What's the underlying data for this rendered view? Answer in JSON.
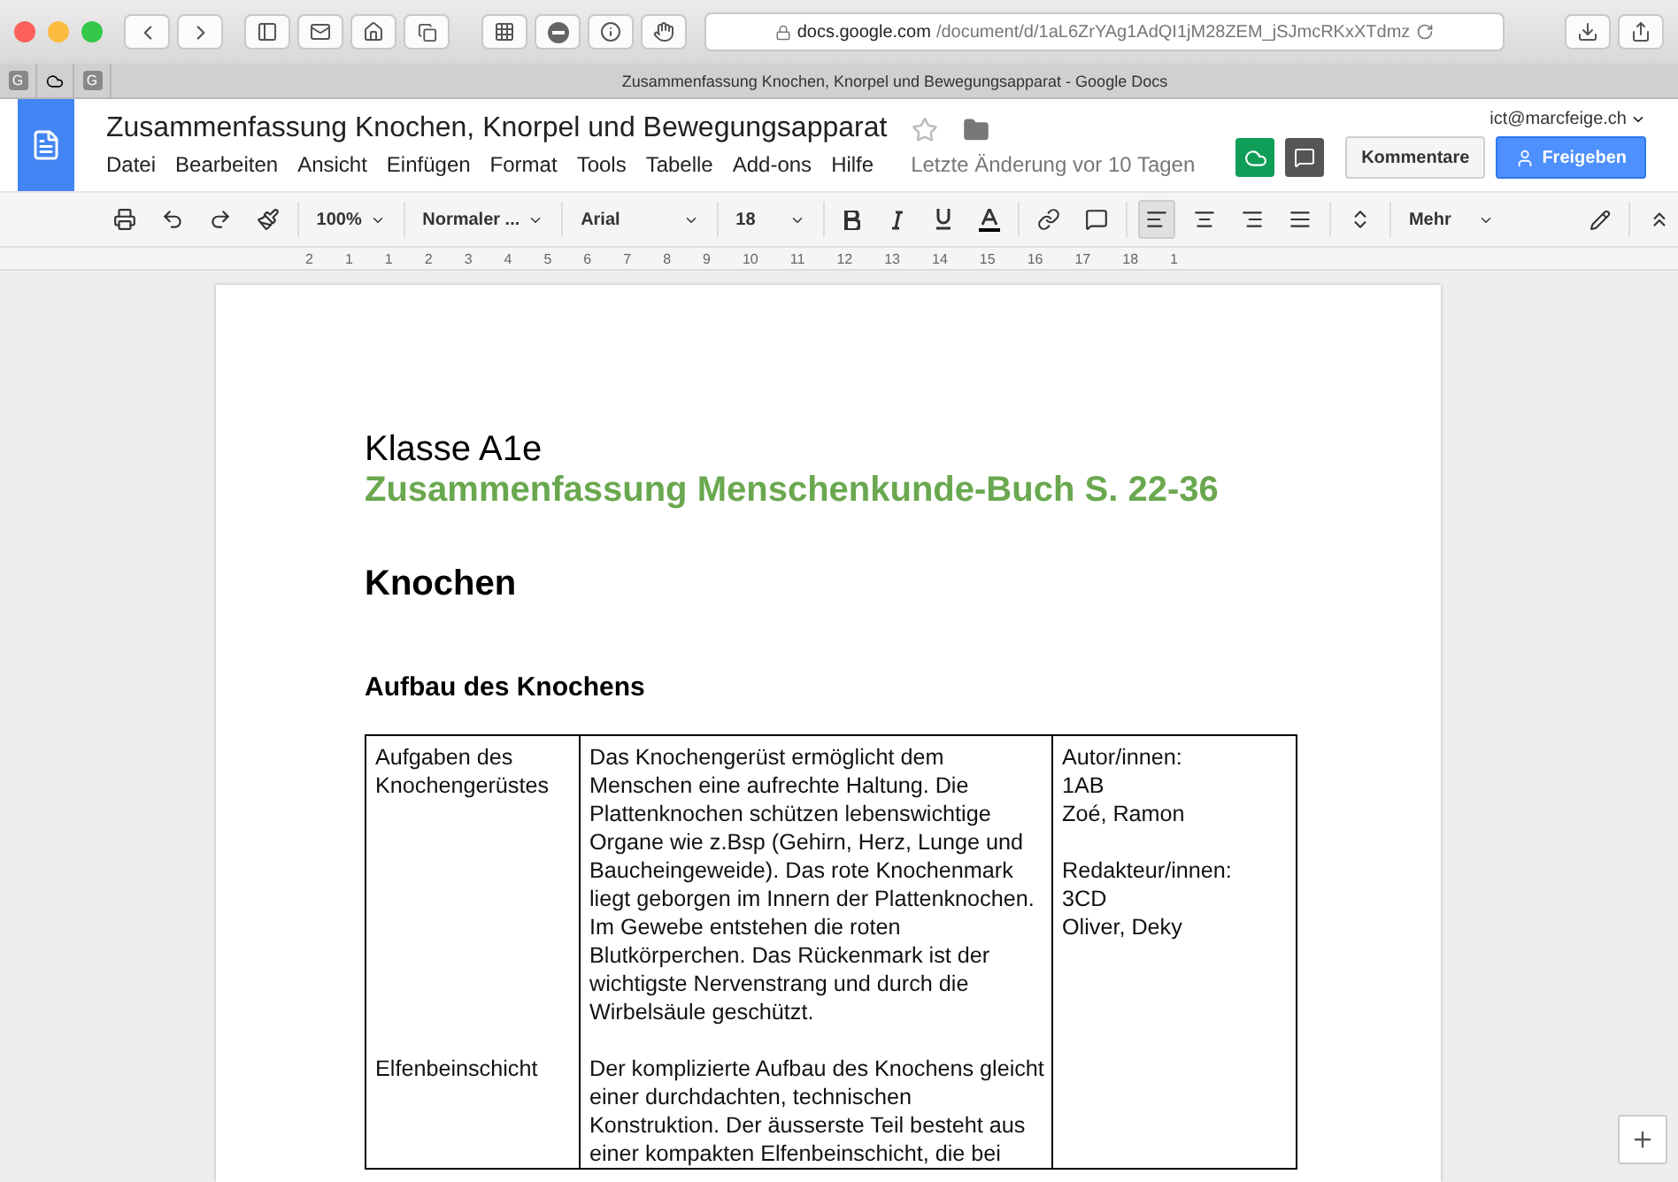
{
  "browser": {
    "address_domain": "docs.google.com",
    "address_path": "/document/d/1aL6ZrYAg1AdQI1jM28ZEM_jSJmcRKxXTdmz",
    "tab_title": "Zusammenfassung Knochen, Knorpel und Bewegungsapparat - Google Docs",
    "pinned_tabs": [
      {
        "kind": "g",
        "label": "G"
      },
      {
        "kind": "drive"
      },
      {
        "kind": "g",
        "label": "G"
      }
    ]
  },
  "docs": {
    "title": "Zusammenfassung Knochen, Knorpel und Bewegungsapparat",
    "starred": false,
    "menu": [
      "Datei",
      "Bearbeiten",
      "Ansicht",
      "Einfügen",
      "Format",
      "Tools",
      "Tabelle",
      "Add-ons",
      "Hilfe"
    ],
    "last_edit": "Letzte Änderung vor 10 Tagen",
    "account": "ict@marcfeige.ch",
    "comments_button": "Kommentare",
    "share_button": "Freigeben"
  },
  "toolbar": {
    "zoom": "100%",
    "style": "Normaler ...",
    "font": "Arial",
    "size": "18",
    "more": "Mehr",
    "align": [
      {
        "kind": "left",
        "selected": true
      },
      {
        "kind": "center",
        "selected": false
      },
      {
        "kind": "right",
        "selected": false
      },
      {
        "kind": "justify",
        "selected": false
      }
    ]
  },
  "ruler": [
    "2",
    "1",
    "1",
    "2",
    "3",
    "4",
    "5",
    "6",
    "7",
    "8",
    "9",
    "10",
    "11",
    "12",
    "13",
    "14",
    "15",
    "16",
    "17",
    "18",
    "1"
  ],
  "document": {
    "class_line": "Klasse A1e",
    "subtitle": "Zusammenfassung Menschenkunde-Buch S. 22-36",
    "heading": "Knochen",
    "subheading": "Aufbau des Knochens",
    "table": {
      "rows": [
        {
          "label": "Aufgaben des Knochengerüstes",
          "text": "Das Knochengerüst ermöglicht dem Menschen eine aufrechte Haltung. Die Plattenknochen schützen lebenswichtige Organe wie z.Bsp (Gehirn, Herz, Lunge und Baucheingeweide). Das rote Knochenmark liegt geborgen im Innern der Plattenknochen. Im Gewebe entstehen die roten Blutkörperchen. Das Rückenmark ist der wichtigste Nervenstrang und durch die Wirbelsäule geschützt."
        },
        {
          "label": "Elfenbeinschicht",
          "text": "Der  komplizierte Aufbau des Knochens gleicht einer durchdachten, technischen Konstruktion. Der äusserste Teil besteht aus einer kompakten Elfenbeinschicht, die bei"
        }
      ],
      "col_3": [
        {
          "lines": [
            "Autor/innen:",
            "1AB",
            "Zoé, Ramon"
          ]
        },
        {
          "lines": [
            "Redakteur/innen:",
            "3CD",
            "Oliver, Deky"
          ]
        }
      ]
    }
  }
}
